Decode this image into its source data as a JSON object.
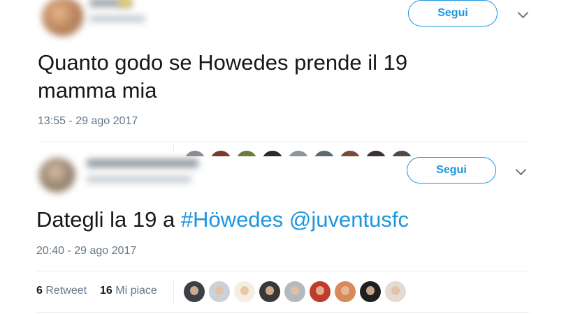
{
  "tweet1": {
    "follow_label": "Segui",
    "text": "Quanto godo se Howedes prende il 19 mamma mia",
    "line1": "Quanto godo se Howedes prende il 19",
    "line2": "mamma mia",
    "timestamp": "13:55 - 29 ago 2017"
  },
  "tweet2": {
    "follow_label": "Segui",
    "text_plain": "Dategli la 19 a ",
    "hashtag": "#Höwedes",
    "mention": "@juventusfc",
    "timestamp": "20:40 - 29 ago 2017",
    "retweets_count": "6",
    "retweets_label": "Retweet",
    "likes_count": "16",
    "likes_label": "Mi piace"
  },
  "colors": {
    "accent": "#1b95e0",
    "text": "#14171a",
    "muted": "#657786",
    "divider": "#e6ecf0"
  },
  "icons": [
    "chevron-down-icon",
    "chevron-down-icon"
  ]
}
